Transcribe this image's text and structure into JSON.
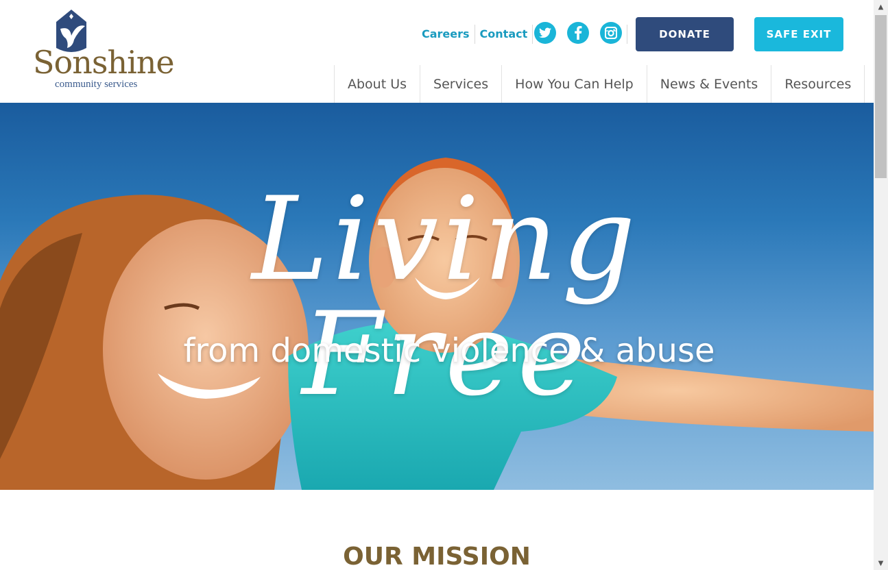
{
  "site": {
    "logo_name": "Sonshine",
    "logo_tagline": "community services"
  },
  "header": {
    "links": [
      {
        "label": "Careers"
      },
      {
        "label": "Contact"
      }
    ],
    "social": [
      {
        "icon": "twitter-icon"
      },
      {
        "icon": "facebook-icon"
      },
      {
        "icon": "instagram-icon"
      }
    ],
    "donate_label": "DONATE",
    "safe_exit_label": "SAFE EXIT"
  },
  "nav": {
    "items": [
      {
        "label": "About Us"
      },
      {
        "label": "Services"
      },
      {
        "label": "How You Can Help"
      },
      {
        "label": "News & Events"
      },
      {
        "label": "Resources"
      }
    ]
  },
  "hero": {
    "script_title": "Living Free",
    "subtitle": "from domestic violence & abuse"
  },
  "mission": {
    "heading": "OUR MISSION"
  },
  "colors": {
    "brand_gold": "#7a6234",
    "brand_navy": "#2f4b7c",
    "accent_cyan": "#1ab8dc",
    "link_blue": "#1a9bbf"
  }
}
